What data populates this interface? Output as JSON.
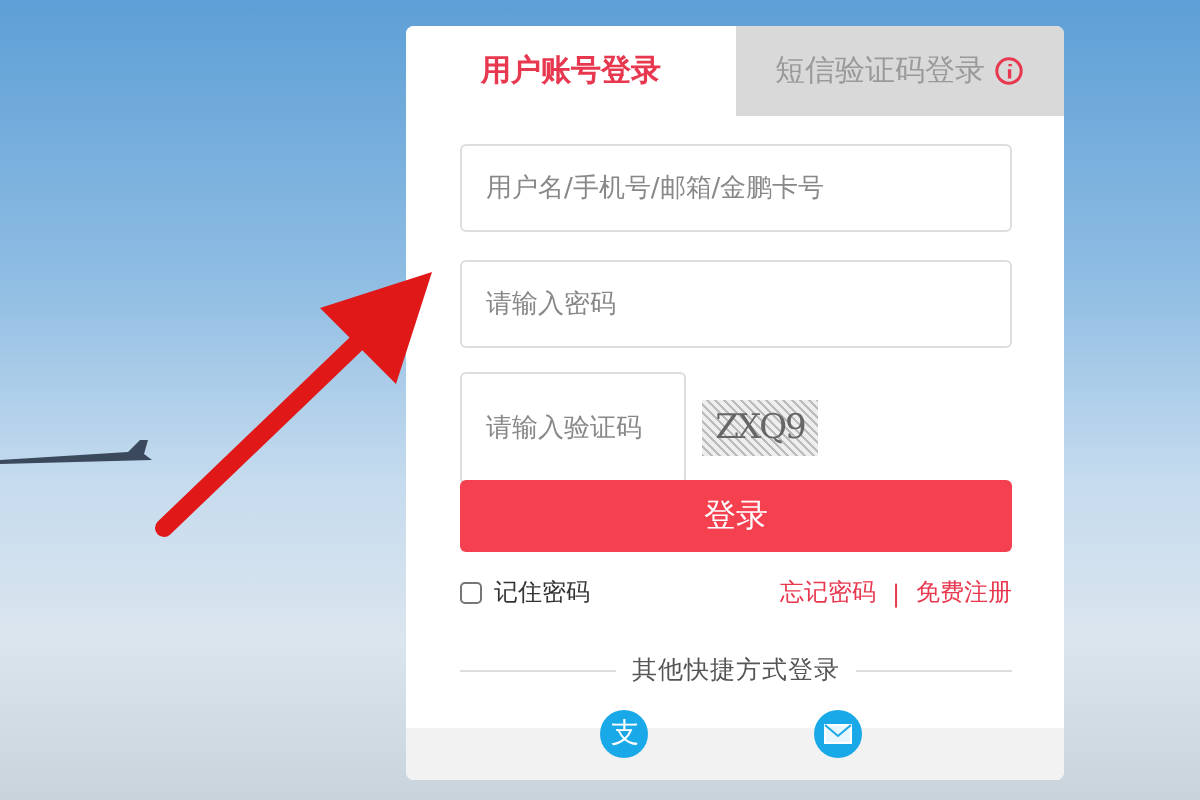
{
  "tabs": [
    {
      "label": "用户账号登录",
      "selected": true,
      "info_icon": false
    },
    {
      "label": "短信验证码登录",
      "selected": false,
      "info_icon": true
    }
  ],
  "fields": [
    {
      "kind": "text",
      "placeholder": "用户名/手机号/邮箱/金鹏卡号"
    },
    {
      "kind": "password",
      "placeholder": "请输入密码"
    },
    {
      "kind": "captcha",
      "placeholder": "请输入验证码",
      "captcha_text": "ZXQ9"
    }
  ],
  "login_button": "登录",
  "remember": {
    "label": "记住密码",
    "checked": false
  },
  "links": [
    "忘记密码",
    "免费注册"
  ],
  "link_separator": "|",
  "quick_login": {
    "title": "其他快捷方式登录",
    "options": [
      {
        "kind": "pay",
        "glyph": "支"
      },
      {
        "kind": "mail"
      }
    ]
  }
}
